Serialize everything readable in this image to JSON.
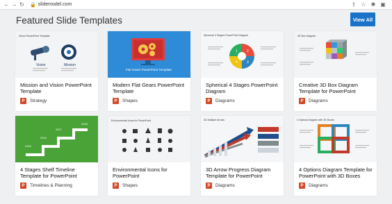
{
  "browser": {
    "url": "slidemodel.com"
  },
  "section": {
    "heading": "Featured Slide Templates",
    "view_all_label": "View All"
  },
  "cards": [
    {
      "title": "Mission and Vision PowerPoint Template",
      "category": "Strategy",
      "thumb_title": "Vision PowerPoint Template",
      "thumb_labels": [
        "Vision",
        "Mission"
      ]
    },
    {
      "title": "Modern Flat Gears PowerPoint Template",
      "category": "Shapes",
      "thumb_caption": "Flat Gears PowerPoint Template"
    },
    {
      "title": "Spherical 4 Stages PowerPoint Diagram",
      "category": "Diagrams",
      "thumb_title": "Spherical 4 Stages PowerPoint Diagram",
      "thumb_labels": [
        "1",
        "2",
        "3",
        "4"
      ]
    },
    {
      "title": "Creative 3D Box Diagram Template for PowerPoint",
      "category": "Diagrams",
      "thumb_title": "3D Box Diagram"
    },
    {
      "title": "4 Stages Shelf Timeline Template for PowerPoint",
      "category": "Timelines & Planning",
      "thumb_labels": [
        "2015",
        "2016",
        "2017",
        "2018"
      ]
    },
    {
      "title": "Environmental Icons for PowerPoint",
      "category": "Shapes",
      "thumb_title": "Environmental Icons for PowerPoint"
    },
    {
      "title": "3D Arrow Progress Diagram Template for PowerPoint",
      "category": "Diagrams",
      "thumb_title": "3D Multiple Arrows"
    },
    {
      "title": "4 Options Diagram Template for PowerPoint with 3D Boxes",
      "category": "Diagrams",
      "thumb_title": "4 Options Diagram with 3D Boxes"
    }
  ],
  "colors": {
    "accent": "#1a73c8",
    "ppt_badge": "#d24726"
  }
}
